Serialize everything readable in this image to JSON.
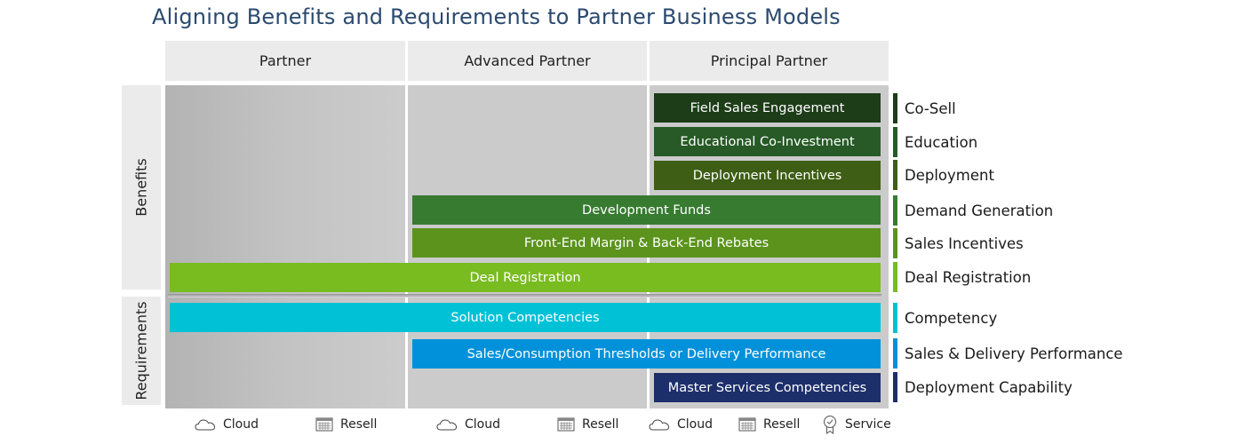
{
  "title": "Aligning Benefits and Requirements to Partner Business Models",
  "tiers": [
    {
      "label": "Partner"
    },
    {
      "label": "Advanced Partner"
    },
    {
      "label": "Principal Partner"
    }
  ],
  "sections": {
    "benefits": "Benefits",
    "requirements": "Requirements"
  },
  "bars": [
    {
      "label": "Field Sales Engagement",
      "color": "#1c3d18",
      "tiers": [
        "Principal Partner"
      ],
      "section": "benefits"
    },
    {
      "label": "Educational Co-Investment",
      "color": "#275a26",
      "tiers": [
        "Principal Partner"
      ],
      "section": "benefits"
    },
    {
      "label": "Deployment Incentives",
      "color": "#3d5e14",
      "tiers": [
        "Principal Partner"
      ],
      "section": "benefits"
    },
    {
      "label": "Development Funds",
      "color": "#377b30",
      "tiers": [
        "Advanced Partner",
        "Principal Partner"
      ],
      "section": "benefits"
    },
    {
      "label": "Front-End Margin & Back-End Rebates",
      "color": "#5b931c",
      "tiers": [
        "Advanced Partner",
        "Principal Partner"
      ],
      "section": "benefits"
    },
    {
      "label": "Deal Registration",
      "color": "#78bc20",
      "tiers": [
        "Partner",
        "Advanced Partner",
        "Principal Partner"
      ],
      "section": "benefits"
    },
    {
      "label": "Solution Competencies",
      "color": "#00c1d5",
      "tiers": [
        "Partner",
        "Advanced Partner",
        "Principal Partner"
      ],
      "section": "requirements"
    },
    {
      "label": "Sales/Consumption Thresholds or Delivery Performance",
      "color": "#0091da",
      "tiers": [
        "Advanced Partner",
        "Principal Partner"
      ],
      "section": "requirements"
    },
    {
      "label": "Master Services Competencies",
      "color": "#1d2f6b",
      "tiers": [
        "Principal Partner"
      ],
      "section": "requirements"
    }
  ],
  "legend": [
    {
      "label": "Co-Sell",
      "color": "#1c3d18"
    },
    {
      "label": "Education",
      "color": "#275a26"
    },
    {
      "label": "Deployment",
      "color": "#3d5e14"
    },
    {
      "label": "Demand Generation",
      "color": "#377b30"
    },
    {
      "label": "Sales Incentives",
      "color": "#5b931c"
    },
    {
      "label": "Deal Registration",
      "color": "#78bc20"
    },
    {
      "label": "Competency",
      "color": "#00c1d5"
    },
    {
      "label": "Sales & Delivery Performance",
      "color": "#0091da"
    },
    {
      "label": "Deployment Capability",
      "color": "#1d2f6b"
    }
  ],
  "footer": [
    {
      "label": "Cloud",
      "icon": "cloud-icon"
    },
    {
      "label": "Resell",
      "icon": "resell-icon"
    },
    {
      "label": "Cloud",
      "icon": "cloud-icon"
    },
    {
      "label": "Resell",
      "icon": "resell-icon"
    },
    {
      "label": "Cloud",
      "icon": "cloud-icon"
    },
    {
      "label": "Resell",
      "icon": "resell-icon"
    },
    {
      "label": "Service",
      "icon": "service-icon"
    }
  ]
}
